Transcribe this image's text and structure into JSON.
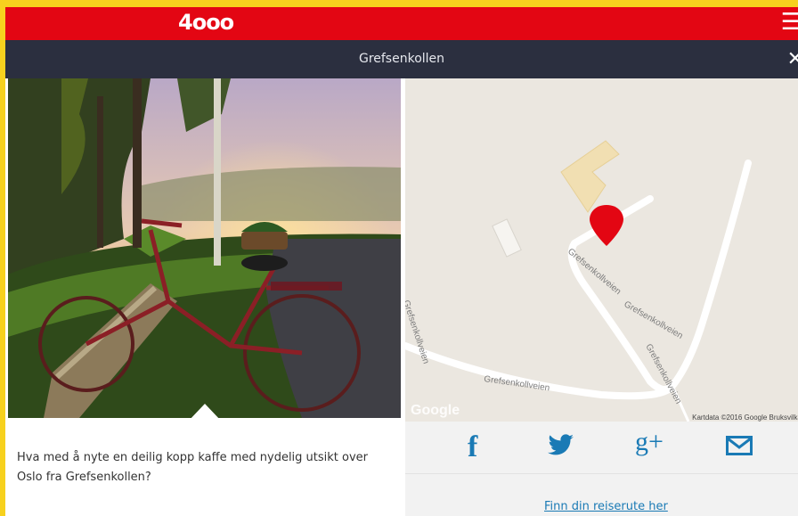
{
  "header": {
    "logo_text": "4ooo",
    "menu_icon": "hamburger-icon"
  },
  "titlebar": {
    "title": "Grefsenkollen",
    "close_icon": "close-icon"
  },
  "map": {
    "labels": [
      "Grefsenkollveien",
      "Grefsenkollveien",
      "Grefsenkollveien",
      "Grefsenkollveien",
      "Grefsenkollveien"
    ],
    "attribution": "Kartdata ©2016 Google  Bruksvilkå",
    "google_logo": "Google"
  },
  "description": "Hva med å nyte en deilig kopp kaffe med nydelig utsikt over Oslo fra Grefsenkollen?",
  "share": {
    "facebook": "f",
    "twitter_icon": "twitter-icon",
    "googleplus": "g+",
    "email_icon": "email-icon"
  },
  "route_link": "Finn din reiserute her",
  "colors": {
    "brand_red": "#e30613",
    "dark_bar": "#2b2f3f",
    "link_blue": "#1a7ab5",
    "border_yellow": "#f7d11e"
  }
}
